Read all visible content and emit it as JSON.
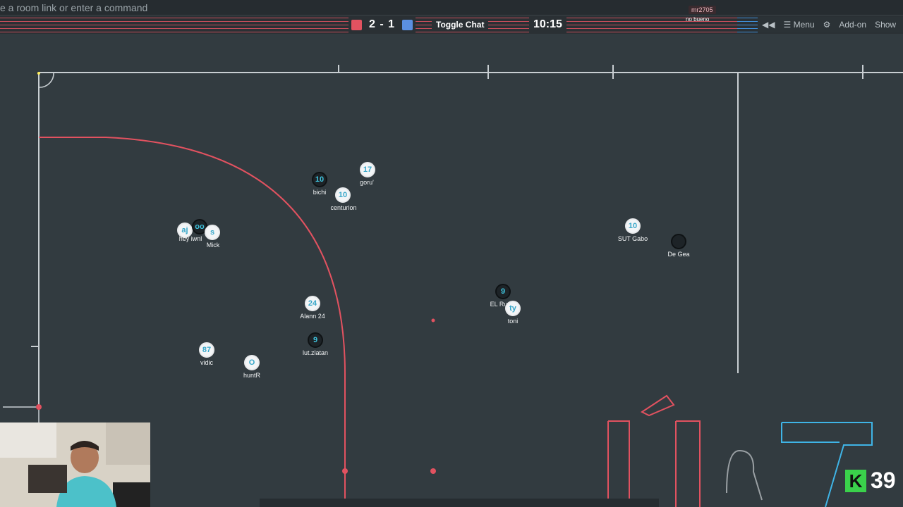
{
  "command": {
    "placeholder": "e a room link or enter a command"
  },
  "scoreboard": {
    "score": "2 - 1",
    "red_color": "#e25260",
    "blue_color": "#5b8fe0"
  },
  "toggle_chat_label": "Toggle Chat",
  "timer": "10:15",
  "menubar": {
    "menu_label": "Menu",
    "addon_label": "Add-on",
    "show_label": "Show"
  },
  "notification": {
    "user": "mr2705",
    "message": "no bueno"
  },
  "players": [
    {
      "id": "bichi",
      "number": "10",
      "name": "bichi",
      "team": "blue"
    },
    {
      "id": "goru",
      "number": "17",
      "name": "goru'",
      "team": "red"
    },
    {
      "id": "centurion",
      "number": "10",
      "name": "centurion",
      "team": "red"
    },
    {
      "id": "aj",
      "number": "aj",
      "name": "hey iwnl",
      "team": "red"
    },
    {
      "id": "oo",
      "number": "oo",
      "name": "",
      "team": "blue"
    },
    {
      "id": "mick",
      "number": "s",
      "name": "Mick",
      "team": "red"
    },
    {
      "id": "sutgabo",
      "number": "10",
      "name": "SUT Gabo",
      "team": "red"
    },
    {
      "id": "degea",
      "number": "",
      "name": "De Gea",
      "team": "blue"
    },
    {
      "id": "elru",
      "number": "9",
      "name": "EL Ru",
      "team": "blue"
    },
    {
      "id": "toni",
      "number": "ty",
      "name": "toni",
      "team": "red"
    },
    {
      "id": "alann",
      "number": "24",
      "name": "Alann 24",
      "team": "red"
    },
    {
      "id": "lutzlatan",
      "number": "9",
      "name": "lut.zlatan",
      "team": "blue"
    },
    {
      "id": "vidic",
      "number": "87",
      "name": "vidic",
      "team": "red"
    },
    {
      "id": "huntr",
      "number": "O",
      "name": "huntR",
      "team": "red"
    }
  ],
  "overlay": {
    "k_label": "K",
    "k_number": "39",
    "k_color": "#3ad14b"
  },
  "icons": [
    "back-icon",
    "menu-icon",
    "gear-icon"
  ]
}
